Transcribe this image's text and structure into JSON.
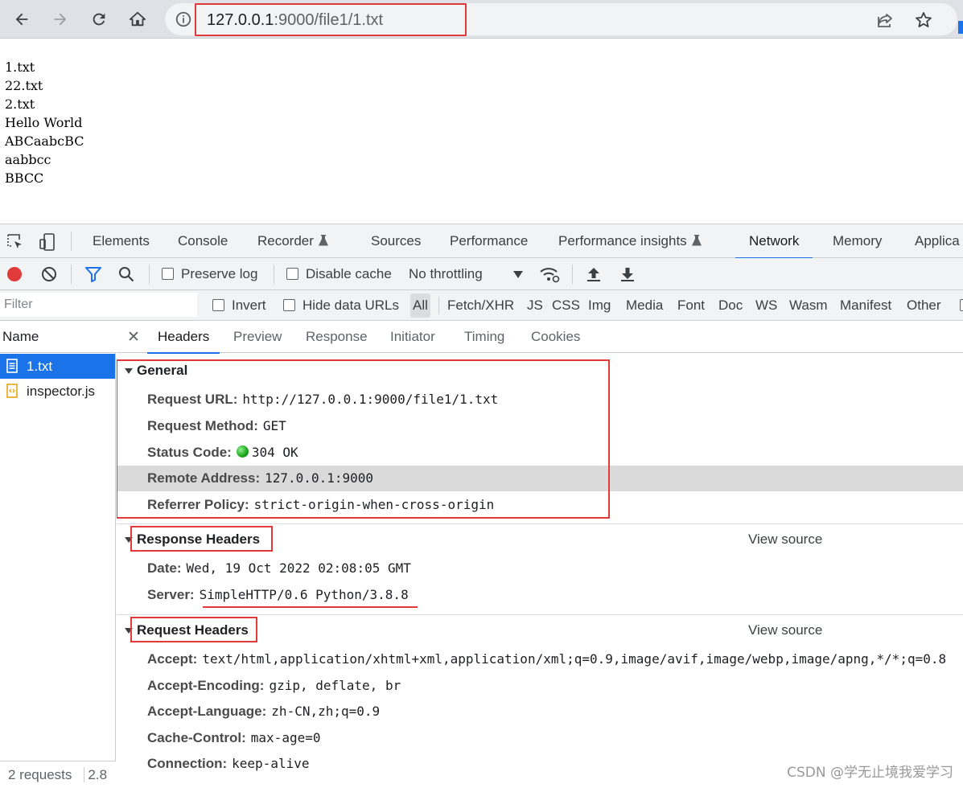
{
  "browser": {
    "url_host": "127.0.0.1",
    "url_rest": ":9000/file1/1.txt"
  },
  "page": {
    "lines": [
      "1.txt",
      "22.txt",
      "2.txt",
      "Hello World",
      "ABCaabcBC",
      "aabbcc",
      "BBCC"
    ]
  },
  "devtools": {
    "tabs": [
      "Elements",
      "Console",
      "Recorder",
      "Sources",
      "Performance",
      "Performance insights",
      "Network",
      "Memory",
      "Applica"
    ],
    "active_tab": "Network",
    "toolbar": {
      "preserve_log": "Preserve log",
      "disable_cache": "Disable cache",
      "throttling": "No throttling"
    },
    "filter": {
      "placeholder": "Filter",
      "invert": "Invert",
      "hide_data_urls": "Hide data URLs",
      "types": [
        "All",
        "Fetch/XHR",
        "JS",
        "CSS",
        "Img",
        "Media",
        "Font",
        "Doc",
        "WS",
        "Wasm",
        "Manifest",
        "Other"
      ]
    },
    "name_panel": {
      "header": "Name",
      "files": [
        "1.txt",
        "inspector.js"
      ],
      "status": "2 requests",
      "status_extra": "2.8"
    },
    "detail_tabs": [
      "Headers",
      "Preview",
      "Response",
      "Initiator",
      "Timing",
      "Cookies"
    ],
    "general": {
      "title": "General",
      "rows": [
        {
          "key": "Request URL:",
          "value": "http://127.0.0.1:9000/file1/1.txt"
        },
        {
          "key": "Request Method:",
          "value": "GET"
        },
        {
          "key": "Status Code:",
          "value": "304 OK"
        },
        {
          "key": "Remote Address:",
          "value": "127.0.0.1:9000"
        },
        {
          "key": "Referrer Policy:",
          "value": "strict-origin-when-cross-origin"
        }
      ]
    },
    "response_headers": {
      "title": "Response Headers",
      "view_source": "View source",
      "rows": [
        {
          "key": "Date:",
          "value": "Wed, 19 Oct 2022 02:08:05 GMT"
        },
        {
          "key": "Server:",
          "value": "SimpleHTTP/0.6 Python/3.8.8"
        }
      ]
    },
    "request_headers": {
      "title": "Request Headers",
      "view_source": "View source",
      "rows": [
        {
          "key": "Accept:",
          "value": "text/html,application/xhtml+xml,application/xml;q=0.9,image/avif,image/webp,image/apng,*/*;q=0.8"
        },
        {
          "key": "Accept-Encoding:",
          "value": "gzip, deflate, br"
        },
        {
          "key": "Accept-Language:",
          "value": "zh-CN,zh;q=0.9"
        },
        {
          "key": "Cache-Control:",
          "value": "max-age=0"
        },
        {
          "key": "Connection:",
          "value": "keep-alive"
        }
      ]
    }
  },
  "watermark": "CSDN @学无止境我爱学习",
  "colors": {
    "accent": "#1a73e8",
    "annotation_red": "#e03a3a",
    "status_green": "#18a418"
  }
}
